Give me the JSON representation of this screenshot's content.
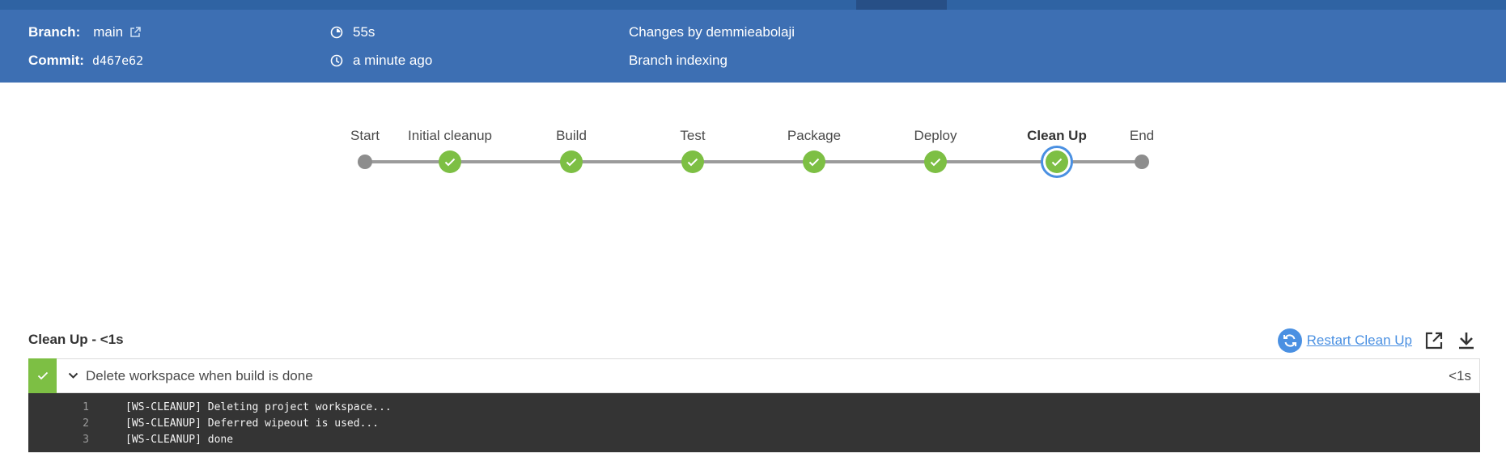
{
  "header": {
    "branch_label": "Branch:",
    "branch_value": "main",
    "commit_label": "Commit:",
    "commit_value": "d467e62",
    "duration": "55s",
    "time_ago": "a minute ago",
    "changes": "Changes by demmieabolaji",
    "cause": "Branch indexing",
    "icons": [
      "external-link-icon",
      "duration-icon",
      "clock-icon"
    ]
  },
  "pipeline": {
    "stages": [
      {
        "label": "Start",
        "status": "start"
      },
      {
        "label": "Initial cleanup",
        "status": "success"
      },
      {
        "label": "Build",
        "status": "success"
      },
      {
        "label": "Test",
        "status": "success"
      },
      {
        "label": "Package",
        "status": "success"
      },
      {
        "label": "Deploy",
        "status": "success"
      },
      {
        "label": "Clean Up",
        "status": "success",
        "selected": true
      },
      {
        "label": "End",
        "status": "end"
      }
    ]
  },
  "step_panel": {
    "title": "Clean Up - <1s",
    "restart_label": "Restart Clean Up",
    "step": {
      "name": "Delete workspace when build is done",
      "duration": "<1s",
      "status": "success"
    },
    "log": [
      {
        "n": "1",
        "text": "[WS-CLEANUP] Deleting project workspace..."
      },
      {
        "n": "2",
        "text": "[WS-CLEANUP] Deferred wipeout is used..."
      },
      {
        "n": "3",
        "text": "[WS-CLEANUP] done"
      }
    ]
  },
  "colors": {
    "header_bg": "#3d6fb3",
    "success": "#7dbf44",
    "selected_ring": "#4a90e2",
    "log_bg": "#343434"
  }
}
